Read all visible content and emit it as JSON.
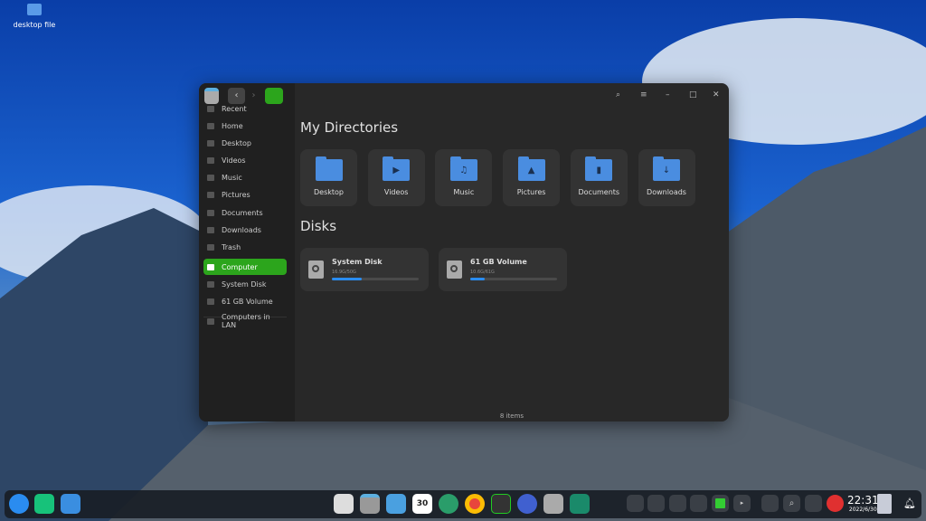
{
  "desktop": {
    "icon_label": "desktop file"
  },
  "window": {
    "sidebar": [
      {
        "label": "Recent"
      },
      {
        "label": "Home"
      },
      {
        "label": "Desktop"
      },
      {
        "label": "Videos"
      },
      {
        "label": "Music"
      },
      {
        "label": "Pictures"
      },
      {
        "label": "Documents"
      },
      {
        "label": "Downloads"
      },
      {
        "label": "Trash"
      },
      {
        "label": "Computer",
        "active": true
      },
      {
        "label": "System Disk"
      },
      {
        "label": "61 GB Volume"
      },
      {
        "label": "Computers in LAN"
      }
    ],
    "dirs_title": "My Directories",
    "dirs": [
      {
        "label": "Desktop",
        "icon": "desktop-icon"
      },
      {
        "label": "Videos",
        "icon": "video-icon"
      },
      {
        "label": "Music",
        "icon": "music-icon"
      },
      {
        "label": "Pictures",
        "icon": "picture-icon"
      },
      {
        "label": "Documents",
        "icon": "document-icon"
      },
      {
        "label": "Downloads",
        "icon": "download-icon"
      }
    ],
    "disks_title": "Disks",
    "disks": [
      {
        "name": "System Disk",
        "usage": "16.9G/50G",
        "percent": 34
      },
      {
        "name": "61 GB Volume",
        "usage": "10.6G/61G",
        "percent": 17
      }
    ],
    "status": "8 items"
  },
  "taskbar": {
    "time": "22:31",
    "date": "2022/6/30",
    "calendar_day": "30",
    "accent": "#2ca51c"
  }
}
